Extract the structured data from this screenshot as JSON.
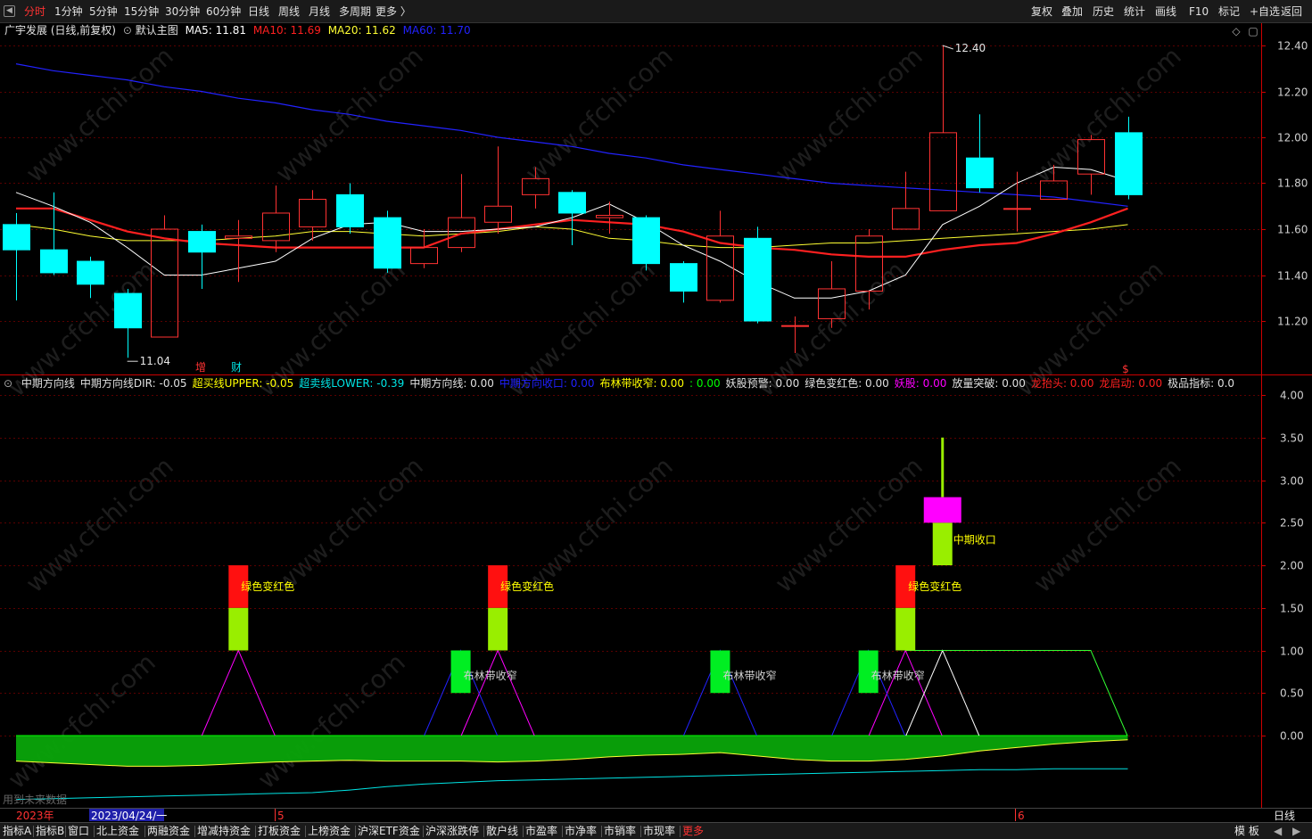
{
  "periods": [
    "分时",
    "1分钟",
    "5分钟",
    "15分钟",
    "30分钟",
    "60分钟",
    "日线",
    "周线",
    "月线",
    "多周期",
    "更多 〉"
  ],
  "active_period": "分时",
  "tools": [
    "复权",
    "叠加",
    "历史",
    "统计",
    "画线",
    "F10",
    "标记",
    "+自选",
    "返回"
  ],
  "main_legend": {
    "title": "广宇发展 (日线,前复权)",
    "template": "默认主图",
    "ma5": "MA5: 11.81",
    "ma10": "MA10: 11.69",
    "ma20": "MA20: 11.62",
    "ma60": "MA60: 11.70"
  },
  "main_markers": {
    "high": "12.40",
    "low": "11.04",
    "zeng": "增",
    "cai": "财",
    "s": "$"
  },
  "ind_legend": [
    {
      "text": "中期方向线",
      "color": "#e0e0e0"
    },
    {
      "text": "中期方向线DIR: -0.05",
      "color": "#e0e0e0"
    },
    {
      "text": "超买线UPPER: -0.05",
      "color": "#ffff00"
    },
    {
      "text": "超卖线LOWER: -0.39",
      "color": "#00e5e5"
    },
    {
      "text": "中期方向线: 0.00",
      "color": "#e0e0e0"
    },
    {
      "text": "中期方向收口: 0.00",
      "color": "#2020ff"
    },
    {
      "text": "布林带收窄: 0.00",
      "color": "#ffff00"
    },
    {
      "text": ": 0.00",
      "color": "#00ff00"
    },
    {
      "text": "妖股预警: 0.00",
      "color": "#e0e0e0"
    },
    {
      "text": "绿色变红色: 0.00",
      "color": "#e0e0e0"
    },
    {
      "text": "妖股: 0.00",
      "color": "#ff00ff"
    },
    {
      "text": "放量突破: 0.00",
      "color": "#e0e0e0"
    },
    {
      "text": "龙抬头: 0.00",
      "color": "#ff2020"
    },
    {
      "text": "龙启动: 0.00",
      "color": "#ff2020"
    },
    {
      "text": "极品指标: 0.0",
      "color": "#e0e0e0"
    }
  ],
  "ind_labels": {
    "green_to_red": "绿色变红色",
    "boll_narrow": "布林带收窄",
    "mid_close": "中期收口",
    "future_data": "用到未来数据"
  },
  "dates": {
    "year": "2023年",
    "cursor": "2023/04/24/一",
    "m5": "5",
    "m6": "6",
    "period": "日线"
  },
  "bottom_tabs": [
    "指标A",
    "指标B",
    "窗口",
    "北上资金",
    "两融资金",
    "增减持资金",
    "打板资金",
    "上榜资金",
    "沪深ETF资金",
    "沪深涨跌停",
    "散户线",
    "市盈率",
    "市净率",
    "市销率",
    "市现率",
    "更多"
  ],
  "bottom_right": [
    "模 板",
    "◀",
    "▶"
  ],
  "watermark": "www.cfchi.com",
  "colors": {
    "up": "#ff3232",
    "down": "#00ffff",
    "ma5": "#ffffff",
    "ma10": "#ff2020",
    "ma20": "#ffff33",
    "ma60": "#2222ff",
    "grid": "#5a0000",
    "axis": "#cc0000"
  },
  "chart_data": [
    {
      "type": "candlestick",
      "title": "广宇发展 (日线,前复权)",
      "ylim": [
        11.0,
        12.45
      ],
      "yticks": [
        "12.40",
        "12.20",
        "12.00",
        "11.80",
        "11.60",
        "11.40",
        "11.20"
      ],
      "ytick_values": [
        12.4,
        12.2,
        12.0,
        11.8,
        11.6,
        11.4,
        11.2
      ],
      "candles": [
        {
          "o": 11.62,
          "c": 11.51,
          "h": 11.67,
          "l": 11.29
        },
        {
          "o": 11.51,
          "c": 11.41,
          "h": 11.76,
          "l": 11.4
        },
        {
          "o": 11.46,
          "c": 11.36,
          "h": 11.48,
          "l": 11.3
        },
        {
          "o": 11.32,
          "c": 11.17,
          "h": 11.34,
          "l": 11.04
        },
        {
          "o": 11.13,
          "c": 11.6,
          "h": 11.66,
          "l": 11.13
        },
        {
          "o": 11.59,
          "c": 11.5,
          "h": 11.62,
          "l": 11.34
        },
        {
          "o": 11.56,
          "c": 11.57,
          "h": 11.64,
          "l": 11.37
        },
        {
          "o": 11.55,
          "c": 11.67,
          "h": 11.79,
          "l": 11.5
        },
        {
          "o": 11.61,
          "c": 11.73,
          "h": 11.77,
          "l": 11.55
        },
        {
          "o": 11.75,
          "c": 11.61,
          "h": 11.8,
          "l": 11.58
        },
        {
          "o": 11.65,
          "c": 11.43,
          "h": 11.68,
          "l": 11.41
        },
        {
          "o": 11.45,
          "c": 11.52,
          "h": 11.6,
          "l": 11.43
        },
        {
          "o": 11.52,
          "c": 11.65,
          "h": 11.84,
          "l": 11.5
        },
        {
          "o": 11.63,
          "c": 11.7,
          "h": 11.96,
          "l": 11.58
        },
        {
          "o": 11.75,
          "c": 11.82,
          "h": 11.87,
          "l": 11.69
        },
        {
          "o": 11.76,
          "c": 11.67,
          "h": 11.77,
          "l": 11.53
        },
        {
          "o": 11.65,
          "c": 11.66,
          "h": 11.72,
          "l": 11.58
        },
        {
          "o": 11.65,
          "c": 11.45,
          "h": 11.66,
          "l": 11.42
        },
        {
          "o": 11.45,
          "c": 11.33,
          "h": 11.46,
          "l": 11.28
        },
        {
          "o": 11.29,
          "c": 11.57,
          "h": 11.68,
          "l": 11.28
        },
        {
          "o": 11.56,
          "c": 11.2,
          "h": 11.61,
          "l": 11.19
        },
        {
          "o": 11.18,
          "c": 11.18,
          "h": 11.22,
          "l": 11.06
        },
        {
          "o": 11.21,
          "c": 11.34,
          "h": 11.46,
          "l": 11.17
        },
        {
          "o": 11.33,
          "c": 11.57,
          "h": 11.6,
          "l": 11.25
        },
        {
          "o": 11.6,
          "c": 11.69,
          "h": 11.85,
          "l": 11.6
        },
        {
          "o": 11.68,
          "c": 12.02,
          "h": 12.4,
          "l": 11.68
        },
        {
          "o": 11.91,
          "c": 11.78,
          "h": 12.1,
          "l": 11.76
        },
        {
          "o": 11.69,
          "c": 11.69,
          "h": 11.85,
          "l": 11.59
        },
        {
          "o": 11.73,
          "c": 11.81,
          "h": 11.88,
          "l": 11.73
        },
        {
          "o": 11.84,
          "c": 11.99,
          "h": 12.01,
          "l": 11.75
        },
        {
          "o": 12.02,
          "c": 11.75,
          "h": 12.09,
          "l": 11.73
        }
      ],
      "ma5": [
        11.76,
        11.7,
        11.63,
        11.52,
        11.4,
        11.4,
        11.43,
        11.46,
        11.56,
        11.62,
        11.63,
        11.59,
        11.59,
        11.6,
        11.61,
        11.65,
        11.71,
        11.63,
        11.53,
        11.46,
        11.37,
        11.3,
        11.3,
        11.33,
        11.4,
        11.62,
        11.7,
        11.8,
        11.87,
        11.86,
        11.81
      ],
      "ma10": [
        11.69,
        11.69,
        11.64,
        11.59,
        11.56,
        11.54,
        11.53,
        11.52,
        11.52,
        11.52,
        11.52,
        11.52,
        11.58,
        11.6,
        11.62,
        11.64,
        11.63,
        11.62,
        11.59,
        11.54,
        11.52,
        11.51,
        11.49,
        11.48,
        11.48,
        11.51,
        11.53,
        11.54,
        11.58,
        11.63,
        11.69
      ],
      "ma20": [
        11.62,
        11.6,
        11.57,
        11.55,
        11.55,
        11.55,
        11.56,
        11.57,
        11.59,
        11.59,
        11.58,
        11.57,
        11.58,
        11.59,
        11.61,
        11.6,
        11.56,
        11.55,
        11.53,
        11.52,
        11.52,
        11.53,
        11.54,
        11.54,
        11.55,
        11.56,
        11.57,
        11.58,
        11.59,
        11.6,
        11.62
      ],
      "ma60": [
        12.32,
        12.29,
        12.27,
        12.25,
        12.22,
        12.2,
        12.17,
        12.15,
        12.12,
        12.1,
        12.07,
        12.05,
        12.03,
        12.0,
        11.98,
        11.96,
        11.93,
        11.91,
        11.88,
        11.86,
        11.84,
        11.82,
        11.8,
        11.79,
        11.78,
        11.77,
        11.76,
        11.75,
        11.74,
        11.72,
        11.7
      ]
    },
    {
      "type": "indicator",
      "title": "中期方向线",
      "ylim": [
        -0.9,
        4.2
      ],
      "yticks": [
        "4.00",
        "3.50",
        "3.00",
        "2.50",
        "2.00",
        "1.50",
        "1.00",
        "0.50",
        "0.00"
      ],
      "ytick_values": [
        4.0,
        3.5,
        3.0,
        2.5,
        2.0,
        1.5,
        1.0,
        0.5,
        0.0
      ],
      "dir_line": [
        -0.3,
        -0.32,
        -0.34,
        -0.36,
        -0.36,
        -0.35,
        -0.33,
        -0.31,
        -0.3,
        -0.29,
        -0.3,
        -0.3,
        -0.3,
        -0.31,
        -0.3,
        -0.28,
        -0.25,
        -0.23,
        -0.22,
        -0.2,
        -0.24,
        -0.28,
        -0.3,
        -0.3,
        -0.28,
        -0.24,
        -0.18,
        -0.14,
        -0.1,
        -0.07,
        -0.05
      ],
      "lower_line": [
        -0.75,
        -0.74,
        -0.73,
        -0.72,
        -0.71,
        -0.7,
        -0.69,
        -0.68,
        -0.67,
        -0.64,
        -0.6,
        -0.57,
        -0.55,
        -0.53,
        -0.52,
        -0.51,
        -0.5,
        -0.49,
        -0.48,
        -0.47,
        -0.46,
        -0.45,
        -0.44,
        -0.43,
        -0.42,
        -0.41,
        -0.4,
        -0.4,
        -0.39,
        -0.39,
        -0.39
      ],
      "signals": [
        {
          "index": 6,
          "type": "绿色变红色",
          "base": 1.0,
          "mid": 1.5,
          "top": 2.0
        },
        {
          "index": 13,
          "type": "绿色变红色",
          "base": 1.0,
          "mid": 1.5,
          "top": 2.0
        },
        {
          "index": 24,
          "type": "绿色变红色",
          "base": 1.0,
          "mid": 1.5,
          "top": 2.0
        },
        {
          "index": 12,
          "type": "布林带收窄",
          "base": 0.5,
          "top": 1.0
        },
        {
          "index": 19,
          "type": "布林带收窄",
          "base": 0.5,
          "top": 1.0
        },
        {
          "index": 23,
          "type": "布林带收窄",
          "base": 0.5,
          "top": 1.0
        },
        {
          "index": 25,
          "type": "中期收口",
          "base": 2.0,
          "mid": 2.5,
          "top": 2.8,
          "stem": 3.5
        }
      ],
      "triangles": [
        {
          "index": 6,
          "color": "#ff00ff"
        },
        {
          "index": 13,
          "color": "#ff00ff"
        },
        {
          "index": 24,
          "color": "#ff00ff"
        },
        {
          "index": 12,
          "color": "#2222ff"
        },
        {
          "index": 19,
          "color": "#2222ff"
        },
        {
          "index": 23,
          "color": "#2222ff"
        },
        {
          "index": 25,
          "color": "#ffffff"
        }
      ],
      "plateau": {
        "start": 24,
        "end": 29,
        "value": 1.0,
        "color": "#33ff33"
      }
    }
  ]
}
